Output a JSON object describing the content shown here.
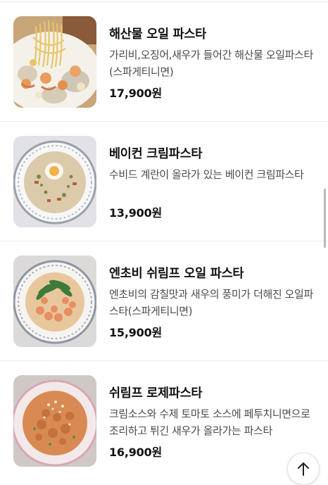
{
  "menu": {
    "items": [
      {
        "name": "해산물 오일 파스타",
        "description": "가리비,오징어,새우가 들어간 해산물 오일파스타(스파게티니면)",
        "price": "17,900원",
        "image": "seafood-oil-pasta-photo"
      },
      {
        "name": "베이컨 크림파스타",
        "description": "수비드 계란이 올라가 있는 베이컨 크림파스타",
        "price": "13,900원",
        "image": "bacon-cream-pasta-photo"
      },
      {
        "name": "엔초비 쉬림프 오일 파스타",
        "description": "엔초비의 감칠맛과 새우의 풍미가 더해진 오일파스타(스파게티니면)",
        "price": "15,900원",
        "image": "anchovy-shrimp-oil-pasta-photo"
      },
      {
        "name": "쉬림프 로제파스타",
        "description": "크림소스와 수제 토마토 소스에 페투치니면으로 조리하고 튀긴 새우가 올라가는 파스타",
        "price": "16,900원",
        "image": "shrimp-rose-pasta-photo"
      }
    ]
  },
  "scroll_top": {
    "icon": "arrow-up-icon"
  },
  "colors": {
    "text": "#111111",
    "description": "#4a4a4a",
    "divider": "#ececec"
  }
}
